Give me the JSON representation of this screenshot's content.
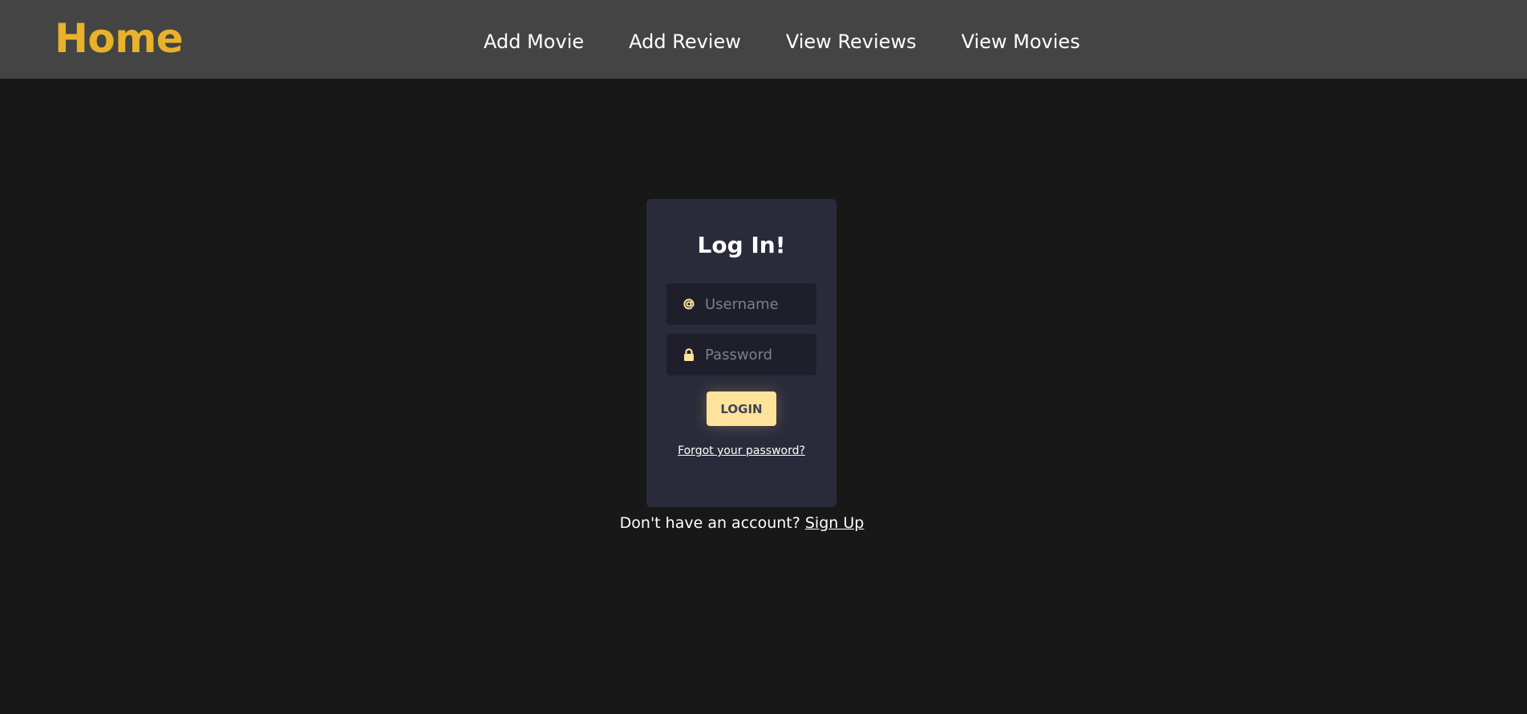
{
  "navbar": {
    "brand": "Home",
    "brand_color": "#e8b22a",
    "links": [
      {
        "label": "Add Movie"
      },
      {
        "label": "Add Review"
      },
      {
        "label": "View Reviews"
      },
      {
        "label": "View Movies"
      }
    ]
  },
  "login": {
    "title": "Log In!",
    "username": {
      "placeholder": "Username",
      "value": "",
      "icon": "at-icon"
    },
    "password": {
      "placeholder": "Password",
      "value": "",
      "icon": "lock-icon"
    },
    "button_label": "LOGIN",
    "forgot_label": "Forgot your password?",
    "accent_color": "#ffe39a"
  },
  "signup": {
    "prompt": "Don't have an account?",
    "link_label": "Sign Up"
  }
}
